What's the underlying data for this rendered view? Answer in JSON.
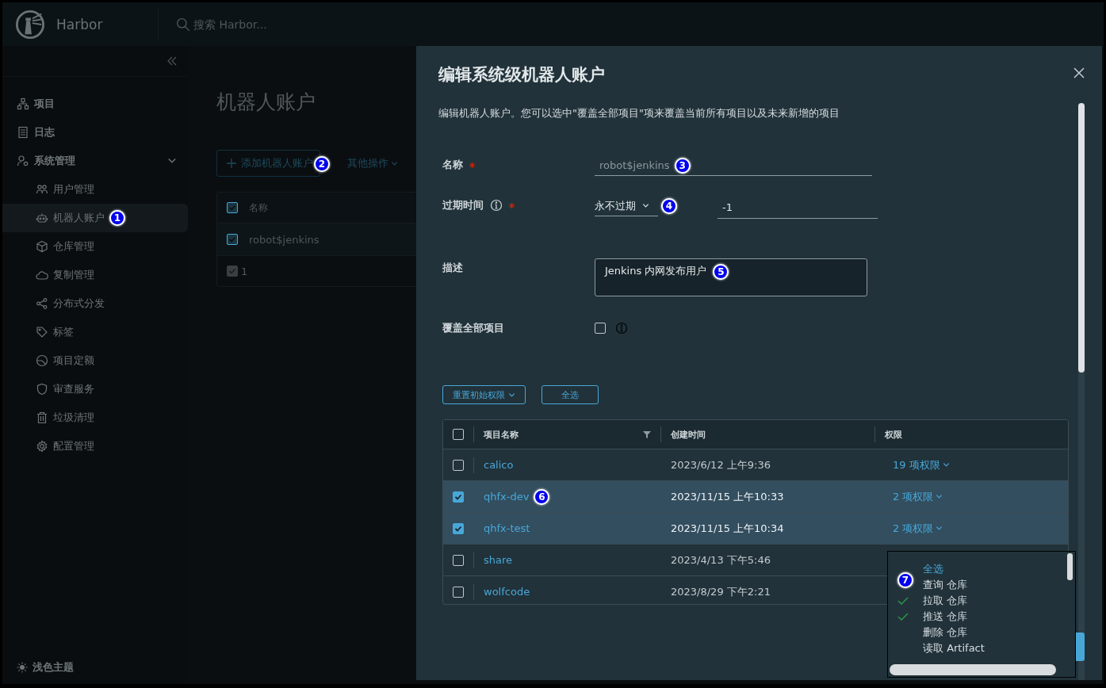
{
  "header": {
    "app_name": "Harbor",
    "search": {
      "placeholder": "搜索 Harbor..."
    }
  },
  "sidebar": {
    "items": [
      {
        "label": "项目",
        "selected": false
      },
      {
        "label": "日志",
        "selected": false
      },
      {
        "label": "系统管理",
        "selected": false,
        "expanded": true,
        "children": [
          {
            "label": "用户管理",
            "selected": false
          },
          {
            "label": "机器人账户",
            "selected": true,
            "callout": "1"
          },
          {
            "label": "仓库管理",
            "selected": false
          },
          {
            "label": "复制管理",
            "selected": false
          },
          {
            "label": "分布式分发",
            "selected": false
          },
          {
            "label": "标签",
            "selected": false
          },
          {
            "label": "项目定额",
            "selected": false
          },
          {
            "label": "审查服务",
            "selected": false
          },
          {
            "label": "垃圾清理",
            "selected": false
          },
          {
            "label": "配置管理",
            "selected": false
          }
        ]
      }
    ],
    "theme_toggle": "浅色主题"
  },
  "page": {
    "title": "机器人账户",
    "add_button": {
      "label": "添加机器人账户",
      "callout": "2"
    },
    "more_actions": "其他操作",
    "table": {
      "columns": [
        "名称"
      ],
      "header_checked": true,
      "rows": [
        {
          "name": "robot$jenkins",
          "checked": true
        }
      ],
      "footer": {
        "count": "1",
        "checked": true
      }
    }
  },
  "modal": {
    "title": "编辑系统级机器人账户",
    "description": "编辑机器人账户。您可以选中\"覆盖全部项目\"项来覆盖当前所有项目以及未来新增的项目",
    "name": {
      "label": "名称",
      "required": true,
      "value": "robot$jenkins",
      "callout": "3"
    },
    "expiration": {
      "label": "过期时间",
      "required": true,
      "select": "永不过期",
      "callout": "4",
      "days": "-1"
    },
    "description_field": {
      "label": "描述",
      "value": "Jenkins 内网发布用户",
      "callout": "5"
    },
    "cover_all": {
      "label": "覆盖全部项目",
      "checked": false
    },
    "reset_button": "重置初始权限",
    "select_all_button": "全选",
    "projects": {
      "columns": [
        "项目名称",
        "创建时间",
        "权限"
      ],
      "header_checked": false,
      "rows": [
        {
          "name": "calico",
          "created": "2023/6/12 上午9:36",
          "permissions": "19 项权限",
          "checked": false
        },
        {
          "name": "qhfx-dev",
          "created": "2023/11/15 上午10:33",
          "permissions": "2 项权限",
          "checked": true,
          "callout": "6"
        },
        {
          "name": "qhfx-test",
          "created": "2023/11/15 上午10:34",
          "permissions": "2 项权限",
          "checked": true
        },
        {
          "name": "share",
          "created": "2023/4/13 下午5:46",
          "checked": false
        },
        {
          "name": "wolfcode",
          "created": "2023/8/29 下午2:21",
          "checked": false
        }
      ]
    },
    "permission_menu": {
      "callout": "7",
      "items": [
        {
          "label": "全选",
          "kind": "action"
        },
        {
          "label": "查询 仓库",
          "kind": "permission",
          "checked": false
        },
        {
          "label": "拉取 仓库",
          "kind": "permission",
          "checked": true
        },
        {
          "label": "推送 仓库",
          "kind": "permission",
          "checked": true
        },
        {
          "label": "删除 仓库",
          "kind": "permission",
          "checked": false
        },
        {
          "label": "读取 Artifact",
          "kind": "permission",
          "checked": false
        }
      ]
    }
  }
}
